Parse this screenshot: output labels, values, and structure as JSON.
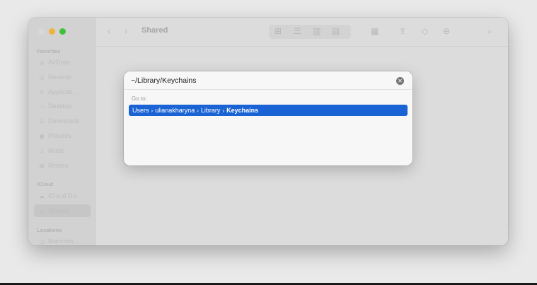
{
  "window": {
    "title": "Shared",
    "sidebar": {
      "sections": [
        {
          "label": "Favorites",
          "items": [
            {
              "label": "AirDrop",
              "icon": "airdrop-icon"
            },
            {
              "label": "Recents",
              "icon": "clock-icon"
            },
            {
              "label": "Applicati...",
              "icon": "applications-icon"
            },
            {
              "label": "Desktop",
              "icon": "desktop-icon"
            },
            {
              "label": "Downloads",
              "icon": "download-icon"
            },
            {
              "label": "Pictures",
              "icon": "pictures-icon"
            },
            {
              "label": "Music",
              "icon": "music-icon"
            },
            {
              "label": "Movies",
              "icon": "movies-icon"
            }
          ]
        },
        {
          "label": "iCloud",
          "items": [
            {
              "label": "iCloud Dri...",
              "icon": "cloud-icon"
            },
            {
              "label": "Shared",
              "icon": "shared-folder-icon",
              "selected": true
            }
          ]
        },
        {
          "label": "Locations",
          "items": [
            {
              "label": "Macintos...",
              "icon": "disk-icon"
            }
          ]
        }
      ]
    }
  },
  "goto_dialog": {
    "path_value": "~/Library/Keychains",
    "goto_label": "Go to:",
    "suggestion": {
      "crumbs": [
        "Users",
        "ulianakharyna",
        "Library",
        "Keychains"
      ]
    }
  },
  "colors": {
    "selection_blue": "#1a63d5",
    "traffic_min": "#f0b33a",
    "traffic_max": "#3ec23a"
  }
}
